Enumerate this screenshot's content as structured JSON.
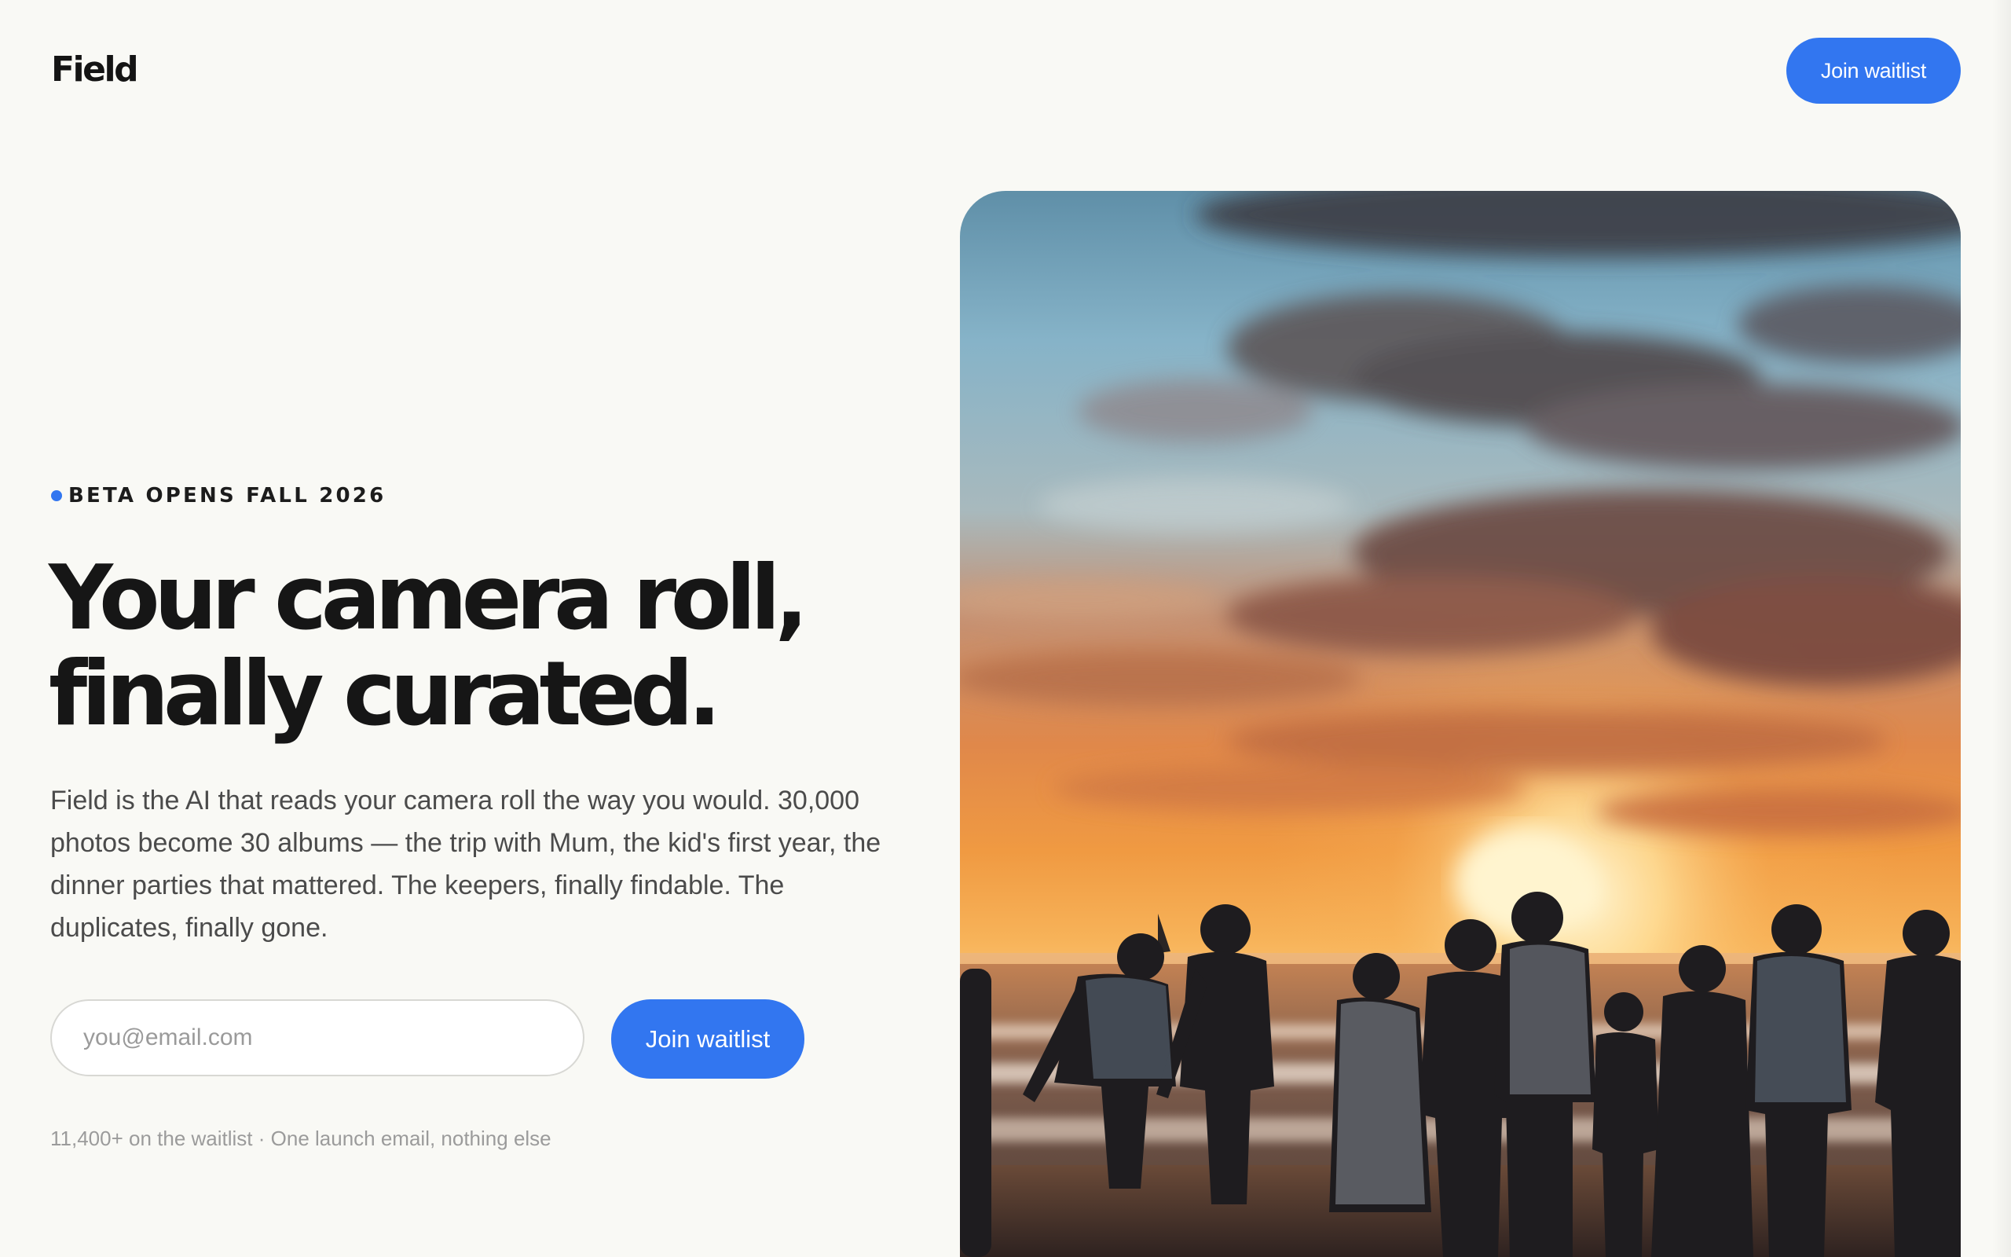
{
  "header": {
    "logo": "Field",
    "cta_label": "Join waitlist"
  },
  "hero": {
    "eyebrow": "BETA OPENS FALL 2026",
    "headline_line1": "Your camera roll,",
    "headline_line2": "finally curated.",
    "body": "Field is the AI that reads your camera roll the way you would. 30,000 photos become 30 albums — the trip with Mum, the kid's first year, the dinner parties that mattered. The keepers, finally findable. The duplicates, finally gone.",
    "email_placeholder": "you@email.com",
    "cta_label": "Join waitlist",
    "fineprint": "11,400+ on the waitlist · One launch email, nothing else"
  },
  "image": {
    "subject": "family silhouettes holding hands on a beach at sunset"
  },
  "colors": {
    "background": "#f9f9f5",
    "accent": "#3276f0",
    "text": "#161616",
    "muted": "#9b9b9b"
  }
}
